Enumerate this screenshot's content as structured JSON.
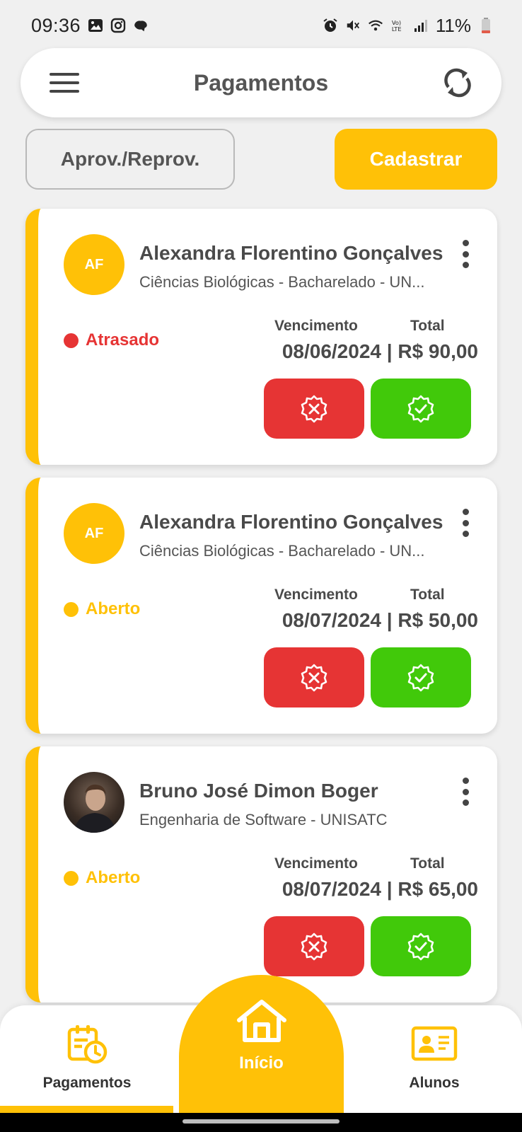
{
  "status_bar": {
    "time": "09:36",
    "battery": "11%"
  },
  "header": {
    "title": "Pagamentos"
  },
  "actions": {
    "approve_reprove": "Aprov./Reprov.",
    "register": "Cadastrar"
  },
  "cards": [
    {
      "initials": "AF",
      "name": "Alexandra Florentino Gonçalves",
      "course": "Ciências Biológicas - Bacharelado - UN...",
      "status": "Atrasado",
      "status_color": "#e63434",
      "due_label": "Vencimento",
      "total_label": "Total",
      "amount_line": "08/06/2024 | R$ 90,00"
    },
    {
      "initials": "AF",
      "name": "Alexandra Florentino Gonçalves",
      "course": "Ciências Biológicas - Bacharelado - UN...",
      "status": "Aberto",
      "status_color": "#ffc107",
      "due_label": "Vencimento",
      "total_label": "Total",
      "amount_line": "08/07/2024 | R$ 50,00"
    },
    {
      "initials": "",
      "name": "Bruno José Dimon Boger",
      "course": "Engenharia de Software - UNISATC",
      "status": "Aberto",
      "status_color": "#ffc107",
      "due_label": "Vencimento",
      "total_label": "Total",
      "amount_line": "08/07/2024 | R$ 65,00"
    }
  ],
  "bottom_nav": {
    "payments": "Pagamentos",
    "home": "Início",
    "students": "Alunos"
  },
  "colors": {
    "accent": "#ffc107",
    "danger": "#e63434",
    "success": "#41c90a"
  }
}
